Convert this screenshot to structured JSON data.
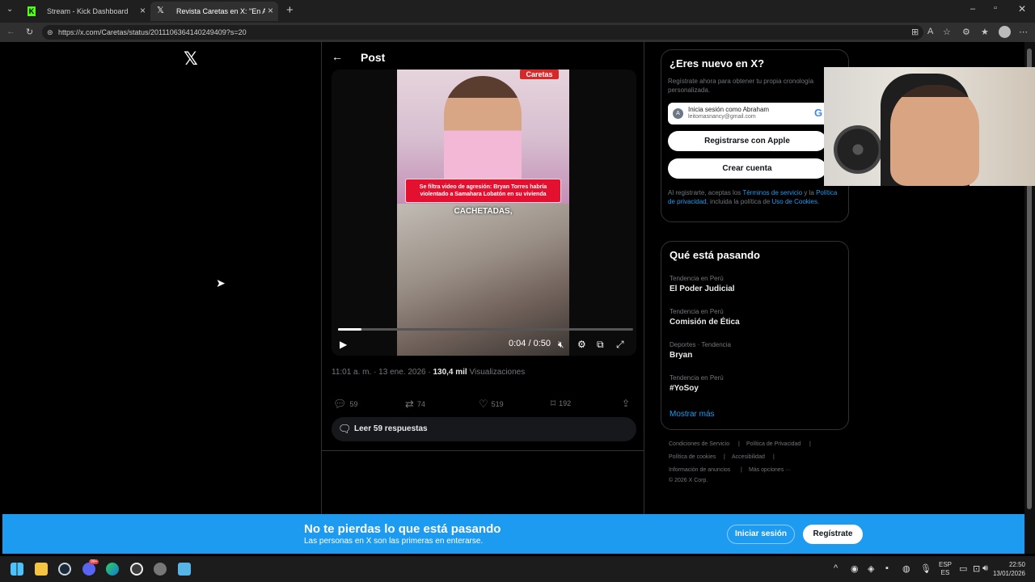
{
  "browser": {
    "tabs": [
      {
        "title": "Stream - Kick Dashboard",
        "active": false
      },
      {
        "title": "Revista Caretas en X: \"En Amor y F",
        "active": true
      }
    ],
    "url": "https://x.com/Caretas/status/2011106364140249409?s=20"
  },
  "header": {
    "back_label": "←",
    "title": "Post"
  },
  "video": {
    "brand": "Caretas",
    "banner_text": "Se filtra video de agresión: Bryan Torres habría violentado a Samahara Lobatón en su vivienda",
    "subtitle": "CACHETADAS,",
    "time": "0:04 / 0:50",
    "progress": 0.08
  },
  "tweet": {
    "timestamp": "11:01 a. m. · 13 ene. 2026 · ",
    "views_count": "130,4 mil",
    "views_label": " Visualizaciones",
    "replies": "59",
    "reposts": "74",
    "likes": "519",
    "bookmarks": "192",
    "read_replies": "Leer 59 respuestas"
  },
  "signup": {
    "title": "¿Eres nuevo en X?",
    "desc": "Regístrate ahora para obtener tu propia cronología personalizada.",
    "google_line1": "Inicia sesión como Abraham",
    "google_line2": "leitomasnancy@gmail.com",
    "apple": "Registrarse con Apple",
    "create": "Crear cuenta",
    "legal_1": "Al registrarte, aceptas los ",
    "legal_terms": "Términos de servicio",
    "legal_2": " y la ",
    "legal_privacy": "Política de privacidad",
    "legal_3": ", incluida la política de ",
    "legal_cookies": "Uso de Cookies",
    "legal_4": "."
  },
  "trends": {
    "title": "Qué está pasando",
    "items": [
      {
        "category": "Tendencia en Perú",
        "name": "El Poder Judicial"
      },
      {
        "category": "Tendencia en Perú",
        "name": "Comisión de Ética"
      },
      {
        "category": "Deportes · Tendencia",
        "name": "Bryan"
      },
      {
        "category": "Tendencia en Perú",
        "name": "#YoSoy"
      }
    ],
    "more": "Mostrar más"
  },
  "footer": {
    "links": [
      "Condiciones de Servicio",
      "Política de Privacidad",
      "Política de cookies",
      "Accesibilidad",
      "Información de anuncios",
      "Más opciones ···"
    ],
    "copyright": "© 2026 X Corp."
  },
  "banner": {
    "title": "No te pierdas lo que está pasando",
    "subtitle": "Las personas en X son las primeras en enterarse.",
    "login": "Iniciar sesión",
    "signup": "Regístrate"
  },
  "taskbar": {
    "lang_1": "ESP",
    "lang_2": "ES",
    "time": "22:50",
    "date": "13/01/2026",
    "discord_badge": "99+"
  },
  "colors": {
    "accent": "#1d9bf0",
    "bg": "#000000",
    "muted": "#71767b"
  }
}
